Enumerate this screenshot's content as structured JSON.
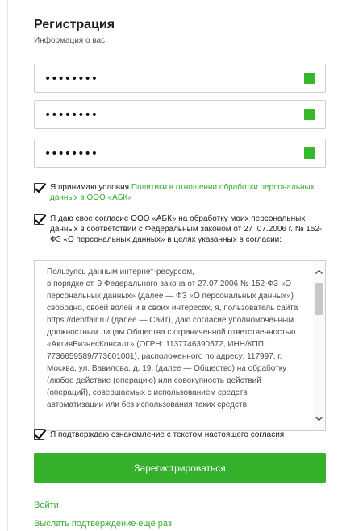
{
  "form": {
    "title": "Регистрация",
    "subtitle": "Информация о вас"
  },
  "fields": [
    {
      "masked_value": "••••••••",
      "status_color": "#35b82c"
    },
    {
      "masked_value": "••••••••",
      "status_color": "#35b82c"
    },
    {
      "masked_value": "••••••••",
      "status_color": "#35b82c"
    }
  ],
  "agree_policy": {
    "checked": true,
    "text_before": "Я принимаю условия ",
    "link_text": "Политики в отношении обработки персональных данных в ООО «АБК»"
  },
  "agree_consent": {
    "checked": true,
    "text": "Я даю свое согласие ООО «АБК» на обработку моих персональных данных в соответствии с Федеральным законом от 27 .07.2006 г. № 152-ФЗ «О персональных данных» в целях указанных в согласии:"
  },
  "consent_text": "Пользуясь данным интернет-ресурсом,\nв порядке ст. 9 Федерального закона от 27.07.2006 № 152-ФЗ «О персональных данных» (далее — ФЗ «О персональных данных») свободно, своей волей и в своих интересах, я, пользователь сайта https://debtfair.ru/ (далее — Сайт), даю согласие уполномоченным должностным лицам Общества с ограниченной ответственностью «АктивБизнесКонсалт» (ОГРН: 1137746390572, ИНН/КПП: 7736659589/773601001), расположенного по адресу: 117997, г. Москва, ул. Вавилова, д. 19, (далее — Общество) на обработку (любое действие (операцию) или совокупность действий (операций), совершаемых с использованием средств автоматизации или без использования таких средств",
  "agree_read": {
    "checked": true,
    "text": "Я подтверждаю ознакомление с текстом настоящего согласия"
  },
  "submit_label": "Зарегистрироваться",
  "login_link": "Войти",
  "resend_link": "Выслать подтверждение ещё раз",
  "colors": {
    "accent": "#34b02b",
    "link": "#3aa832"
  }
}
